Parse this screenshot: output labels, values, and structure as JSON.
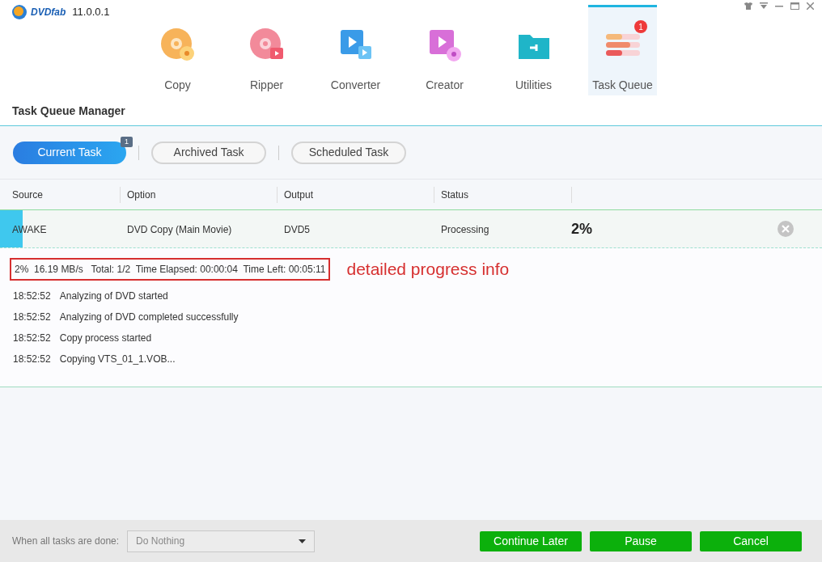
{
  "app": {
    "logo": "DVDfab",
    "version": "11.0.0.1"
  },
  "nav": [
    {
      "label": "Copy",
      "kind": "copy",
      "selected": false
    },
    {
      "label": "Ripper",
      "kind": "ripper",
      "selected": false
    },
    {
      "label": "Converter",
      "kind": "converter",
      "selected": false
    },
    {
      "label": "Creator",
      "kind": "creator",
      "selected": false
    },
    {
      "label": "Utilities",
      "kind": "utilities",
      "selected": false
    },
    {
      "label": "Task Queue",
      "kind": "queue",
      "selected": true,
      "badge": "1"
    }
  ],
  "section_title": "Task Queue Manager",
  "tabs": [
    {
      "label": "Current Task",
      "selected": true,
      "badge": "1"
    },
    {
      "label": "Archived Task",
      "selected": false
    },
    {
      "label": "Scheduled Task",
      "selected": false
    }
  ],
  "table": {
    "columns": [
      "Source",
      "Option",
      "Output",
      "Status"
    ],
    "rows": [
      {
        "source": "AWAKE",
        "option": "DVD Copy (Main Movie)",
        "output": "DVD5",
        "status": "Processing",
        "percent": "2%",
        "level": 0.028
      }
    ]
  },
  "progress_info": "2%  16.19 MB/s   Total: 1/2  Time Elapsed: 00:00:04  Time Left: 00:05:11",
  "annotation": "detailed progress info",
  "log": [
    {
      "time": "18:52:52",
      "message": "Analyzing of DVD started"
    },
    {
      "time": "18:52:52",
      "message": "Analyzing of DVD completed successfully"
    },
    {
      "time": "18:52:52",
      "message": "Copy process started"
    },
    {
      "time": "18:52:52",
      "message": "Copying VTS_01_1.VOB..."
    }
  ],
  "footer": {
    "label": "When all tasks are done:",
    "select_value": "Do Nothing",
    "buttons": [
      "Continue Later",
      "Pause",
      "Cancel"
    ]
  }
}
